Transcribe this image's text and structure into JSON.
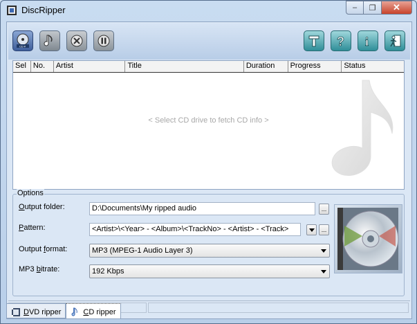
{
  "window": {
    "title": "DiscRipper",
    "caption": {
      "min": "–",
      "max": "❐",
      "close": "✕"
    }
  },
  "toolbar": {
    "left_buttons": [
      {
        "name": "cd-drive-icon"
      },
      {
        "name": "music-note-icon"
      },
      {
        "name": "cancel-icon"
      },
      {
        "name": "pause-icon"
      }
    ],
    "right_buttons": [
      {
        "name": "tools-icon"
      },
      {
        "name": "help-icon"
      },
      {
        "name": "info-icon"
      },
      {
        "name": "exit-icon"
      }
    ]
  },
  "grid": {
    "columns": [
      "Sel",
      "No.",
      "Artist",
      "Title",
      "Duration",
      "Progress",
      "Status"
    ],
    "empty_text": "< Select CD drive to fetch CD info >"
  },
  "options": {
    "legend": "Options",
    "output_folder": {
      "label_pre": "",
      "label_u": "O",
      "label_post": "utput folder:",
      "value": "D:\\Documents\\My ripped audio"
    },
    "pattern": {
      "label_u": "P",
      "label_post": "attern:",
      "value": "<Artist>\\<Year> - <Album>\\<TrackNo> - <Artist> - <Track>"
    },
    "output_format": {
      "label_pre": "Output ",
      "label_u": "f",
      "label_post": "ormat:",
      "value": "MP3 (MPEG-1 Audio Layer 3)"
    },
    "mp3_bitrate": {
      "label_pre": "MP3 ",
      "label_u": "b",
      "label_post": "itrate:",
      "value": "192 Kbps"
    },
    "browse": "..."
  },
  "tabs": [
    {
      "label_u": "D",
      "label_post": "VD ripper",
      "icon": "film-icon",
      "active": false
    },
    {
      "label_u": "C",
      "label_post": "D ripper",
      "icon": "music-note-icon",
      "active": true
    }
  ],
  "colors": {
    "accent": "#2f8e98",
    "grid_text_muted": "#a8a8a8"
  }
}
